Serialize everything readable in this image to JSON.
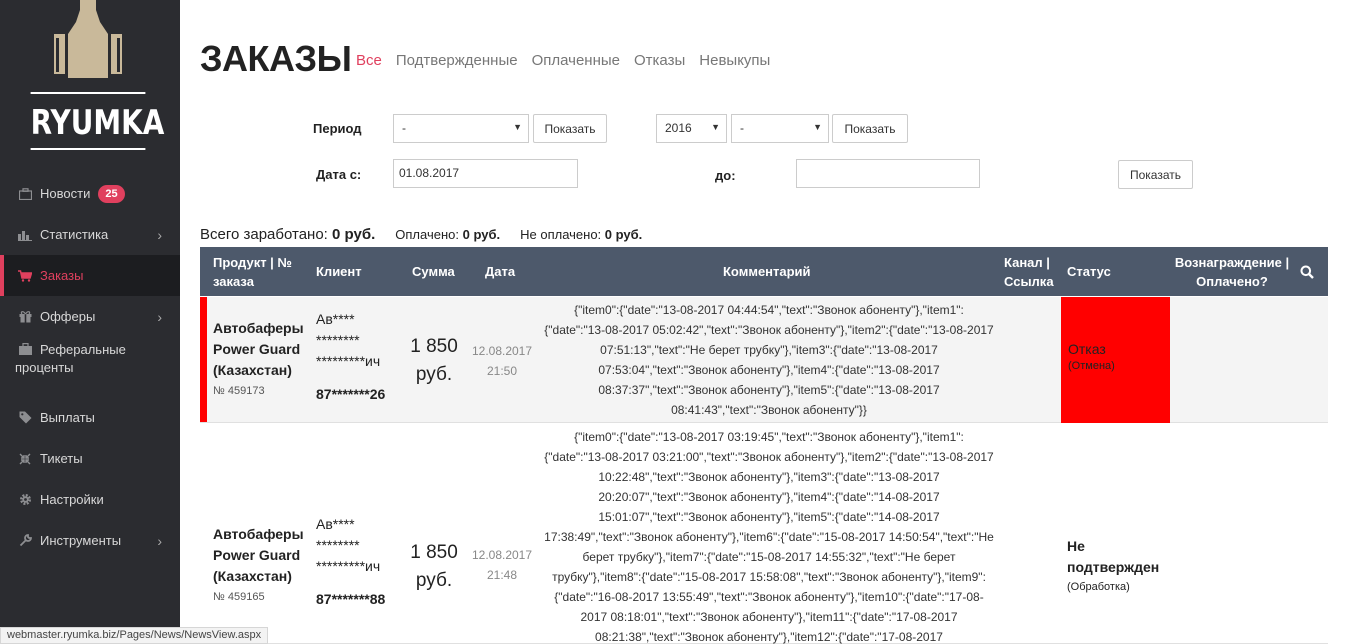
{
  "brand": {
    "name": "RYUMKA"
  },
  "sidebar": {
    "items": [
      {
        "label": "Новости",
        "icon": "briefcase-icon",
        "badge": "25"
      },
      {
        "label": "Статистика",
        "icon": "bar-chart-icon",
        "chevron": true
      },
      {
        "label": "Заказы",
        "icon": "cart-icon",
        "active": true
      },
      {
        "label": "Офферы",
        "icon": "gift-icon",
        "chevron": true
      },
      {
        "label": "Реферальные проценты",
        "icon": "briefcase-icon"
      },
      {
        "label": "Выплаты",
        "icon": "tag-icon"
      },
      {
        "label": "Тикеты",
        "icon": "compress-icon"
      },
      {
        "label": "Настройки",
        "icon": "gear-icon"
      },
      {
        "label": "Инструменты",
        "icon": "wrench-icon",
        "chevron": true
      }
    ]
  },
  "page": {
    "title": "ЗАКАЗЫ",
    "tabs": [
      "Все",
      "Подтвержденные",
      "Оплаченные",
      "Отказы",
      "Невыкупы"
    ],
    "active_tab": "Все"
  },
  "filters": {
    "period_label": "Период",
    "period_value": "-",
    "show_label": "Показать",
    "year_value": "2016",
    "month_value": "-",
    "date_from_label": "Дата с:",
    "date_from_value": "01.08.2017",
    "date_to_label": "до:",
    "date_to_value": ""
  },
  "summary": {
    "total_label": "Всего заработано:",
    "total_value": "0 руб.",
    "paid_label": "Оплачено:",
    "paid_value": "0 руб.",
    "unpaid_label": "Не оплачено:",
    "unpaid_value": "0 руб."
  },
  "table": {
    "headers": {
      "product": "Продукт | № заказа",
      "client": "Клиент",
      "sum": "Сумма",
      "date": "Дата",
      "comment": "Комментарий",
      "channel": "Канал | Ссылка",
      "status": "Статус",
      "reward": "Вознаграждение | Оплачено?"
    },
    "rows": [
      {
        "product": "Автобаферы Power Guard (Казахстан)",
        "order_no": "№ 459173",
        "client_name": "Ав**** ******** *********ич",
        "client_phone": "87*******26",
        "sum": "1 850 руб.",
        "date": "12.08.2017",
        "time": "21:50",
        "comment": "{\"item0\":{\"date\":\"13-08-2017 04:44:54\",\"text\":\"Звонок абоненту\"},\"item1\":{\"date\":\"13-08-2017 05:02:42\",\"text\":\"Звонок абоненту\"},\"item2\":{\"date\":\"13-08-2017 07:51:13\",\"text\":\"Не берет трубку\"},\"item3\":{\"date\":\"13-08-2017 07:53:04\",\"text\":\"Звонок абоненту\"},\"item4\":{\"date\":\"13-08-2017 08:37:37\",\"text\":\"Звонок абоненту\"},\"item5\":{\"date\":\"13-08-2017 08:41:43\",\"text\":\"Звонок абоненту\"}}",
        "status": "Отказ",
        "status_sub": "(Отмена)",
        "status_color": "#ff0000"
      },
      {
        "product": "Автобаферы Power Guard (Казахстан)",
        "order_no": "№ 459165",
        "client_name": "Ав**** ******** *********ич",
        "client_phone": "87*******88",
        "sum": "1 850 руб.",
        "date": "12.08.2017",
        "time": "21:48",
        "comment": "{\"item0\":{\"date\":\"13-08-2017 03:19:45\",\"text\":\"Звонок абоненту\"},\"item1\":{\"date\":\"13-08-2017 03:21:00\",\"text\":\"Звонок абоненту\"},\"item2\":{\"date\":\"13-08-2017 10:22:48\",\"text\":\"Звонок абоненту\"},\"item3\":{\"date\":\"13-08-2017 20:20:07\",\"text\":\"Звонок абоненту\"},\"item4\":{\"date\":\"14-08-2017 15:01:07\",\"text\":\"Звонок абоненту\"},\"item5\":{\"date\":\"14-08-2017 17:38:49\",\"text\":\"Звонок абоненту\"},\"item6\":{\"date\":\"15-08-2017 14:50:54\",\"text\":\"Не берет трубку\"},\"item7\":{\"date\":\"15-08-2017 14:55:32\",\"text\":\"Не берет трубку\"},\"item8\":{\"date\":\"15-08-2017 15:58:08\",\"text\":\"Звонок абоненту\"},\"item9\":{\"date\":\"16-08-2017 13:55:49\",\"text\":\"Звонок абоненту\"},\"item10\":{\"date\":\"17-08-2017 08:18:01\",\"text\":\"Звонок абоненту\"},\"item11\":{\"date\":\"17-08-2017 08:21:38\",\"text\":\"Звонок абоненту\"},\"item12\":{\"date\":\"17-08-2017",
        "status": "Не подтвержден",
        "status_sub": "(Обработка)"
      }
    ]
  },
  "statusbar": {
    "url": "webmaster.ryumka.biz/Pages/News/NewsView.aspx"
  },
  "colors": {
    "accent": "#e0405e",
    "sidebar": "#2b2c30",
    "table_header": "#4d596b",
    "status_refused": "#ff0000"
  }
}
